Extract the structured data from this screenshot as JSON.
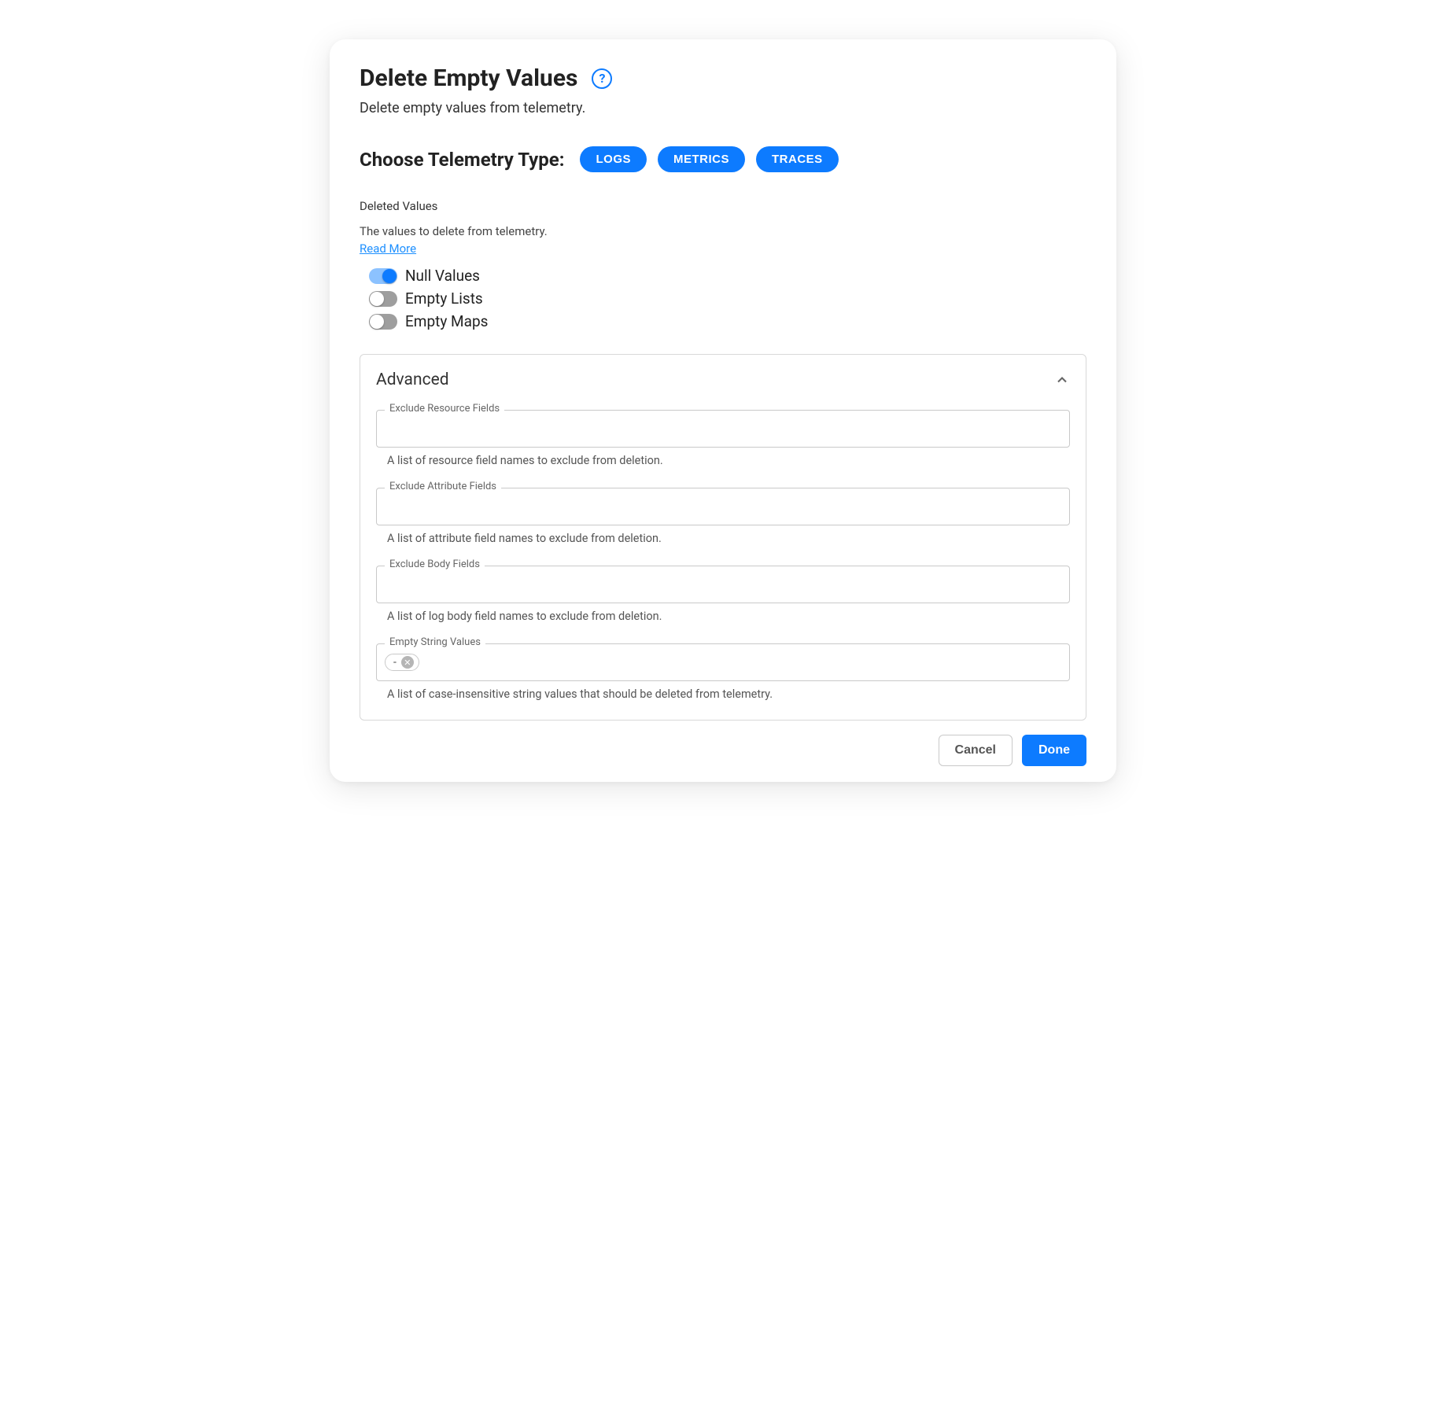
{
  "header": {
    "title": "Delete Empty Values",
    "subtitle": "Delete empty values from telemetry."
  },
  "telemetry": {
    "heading": "Choose Telemetry Type:",
    "options": [
      "LOGS",
      "METRICS",
      "TRACES"
    ]
  },
  "deleted_values": {
    "label": "Deleted Values",
    "description": "The values to delete from telemetry.",
    "read_more": "Read More",
    "toggles": [
      {
        "label": "Null Values",
        "on": true
      },
      {
        "label": "Empty Lists",
        "on": false
      },
      {
        "label": "Empty Maps",
        "on": false
      }
    ]
  },
  "advanced": {
    "title": "Advanced",
    "fields": [
      {
        "label": "Exclude Resource Fields",
        "helper": "A list of resource field names to exclude from deletion.",
        "chips": []
      },
      {
        "label": "Exclude Attribute Fields",
        "helper": "A list of attribute field names to exclude from deletion.",
        "chips": []
      },
      {
        "label": "Exclude Body Fields",
        "helper": "A list of log body field names to exclude from deletion.",
        "chips": []
      },
      {
        "label": "Empty String Values",
        "helper": "A list of case-insensitive string values that should be deleted from telemetry.",
        "chips": [
          "-"
        ]
      }
    ]
  },
  "footer": {
    "cancel": "Cancel",
    "done": "Done"
  }
}
